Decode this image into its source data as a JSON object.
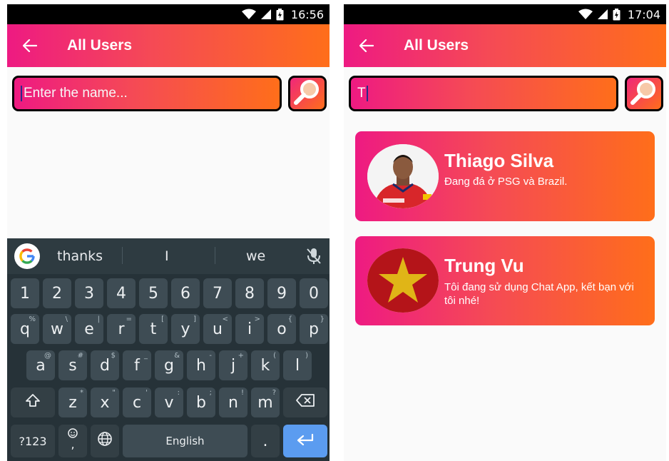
{
  "left_screen": {
    "status": {
      "time": "16:56"
    },
    "appbar": {
      "title": "All Users"
    },
    "search": {
      "placeholder": "Enter the name..."
    },
    "keyboard": {
      "suggestions": [
        "thanks",
        "I",
        "we"
      ],
      "row_numbers": [
        "1",
        "2",
        "3",
        "4",
        "5",
        "6",
        "7",
        "8",
        "9",
        "0"
      ],
      "row1": [
        {
          "k": "q",
          "h": "%"
        },
        {
          "k": "w",
          "h": "\\"
        },
        {
          "k": "e",
          "h": "|"
        },
        {
          "k": "r",
          "h": "="
        },
        {
          "k": "t",
          "h": "["
        },
        {
          "k": "y",
          "h": "]"
        },
        {
          "k": "u",
          "h": "<"
        },
        {
          "k": "i",
          "h": ">"
        },
        {
          "k": "o",
          "h": "{"
        },
        {
          "k": "p",
          "h": "}"
        }
      ],
      "row2": [
        {
          "k": "a",
          "h": "@"
        },
        {
          "k": "s",
          "h": "#"
        },
        {
          "k": "d",
          "h": "$"
        },
        {
          "k": "f",
          "h": "_"
        },
        {
          "k": "g",
          "h": "&"
        },
        {
          "k": "h",
          "h": "-"
        },
        {
          "k": "j",
          "h": "+"
        },
        {
          "k": "k",
          "h": "("
        },
        {
          "k": "l",
          "h": ")"
        }
      ],
      "row3": [
        {
          "k": "z",
          "h": "*"
        },
        {
          "k": "x",
          "h": "\""
        },
        {
          "k": "c",
          "h": "'"
        },
        {
          "k": "v",
          "h": ":"
        },
        {
          "k": "b",
          "h": ";"
        },
        {
          "k": "n",
          "h": "!"
        },
        {
          "k": "m",
          "h": "?"
        }
      ],
      "symbols_label": "?123",
      "comma_label": ",",
      "space_label": "English",
      "period_label": "."
    }
  },
  "right_screen": {
    "status": {
      "time": "17:04"
    },
    "appbar": {
      "title": "All Users"
    },
    "search": {
      "value": "T"
    },
    "users": [
      {
        "name": "Thiago Silva",
        "status": "Đang đá ở PSG và Brazil.",
        "avatar": "player-photo"
      },
      {
        "name": "Trung Vu",
        "status": "Tôi đang sử dụng Chat App, kết bạn với tôi nhé!",
        "avatar": "vietnam-flag"
      }
    ]
  },
  "colors": {
    "gradient_start": "#ee1a82",
    "gradient_end": "#ff6e1a",
    "keyboard_bg": "#263238",
    "enter_key": "#5b9cf0"
  },
  "icons": [
    "wifi-icon",
    "signal-icon",
    "battery-icon",
    "back-arrow-icon",
    "search-icon",
    "google-icon",
    "mic-off-icon",
    "shift-icon",
    "backspace-icon",
    "emoji-icon",
    "globe-icon",
    "enter-icon"
  ]
}
